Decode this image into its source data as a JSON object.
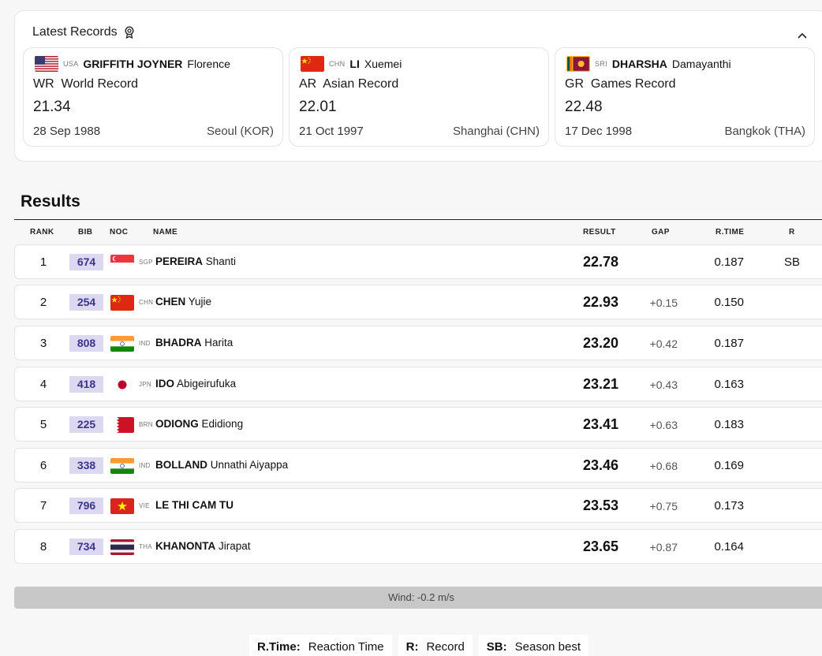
{
  "latest_records": {
    "title": "Latest Records",
    "cards": [
      {
        "noc": "USA",
        "last_name": "GRIFFITH JOYNER",
        "first_name": "Florence",
        "record_type": "WR  World Record",
        "time": "21.34",
        "date": "28 Sep 1988",
        "place": "Seoul (KOR)"
      },
      {
        "noc": "CHN",
        "last_name": "LI",
        "first_name": "Xuemei",
        "record_type": "AR  Asian Record",
        "time": "22.01",
        "date": "21 Oct 1997",
        "place": "Shanghai (CHN)"
      },
      {
        "noc": "SRI",
        "last_name": "DHARSHA",
        "first_name": "Damayanthi",
        "record_type": "GR  Games Record",
        "time": "22.48",
        "date": "17 Dec 1998",
        "place": "Bangkok (THA)"
      }
    ]
  },
  "results": {
    "title": "Results",
    "columns": {
      "rank": "RANK",
      "bib": "BIB",
      "noc": "NOC",
      "name": "NAME",
      "result": "RESULT",
      "gap": "GAP",
      "rtime": "R.TIME",
      "r": "R"
    },
    "rows": [
      {
        "rank": "1",
        "bib": "674",
        "noc": "SGP",
        "last_name": "PEREIRA",
        "first_name": "Shanti",
        "result": "22.78",
        "gap": "",
        "rtime": "0.187",
        "r": "SB"
      },
      {
        "rank": "2",
        "bib": "254",
        "noc": "CHN",
        "last_name": "CHEN",
        "first_name": "Yujie",
        "result": "22.93",
        "gap": "+0.15",
        "rtime": "0.150",
        "r": ""
      },
      {
        "rank": "3",
        "bib": "808",
        "noc": "IND",
        "last_name": "BHADRA",
        "first_name": "Harita",
        "result": "23.20",
        "gap": "+0.42",
        "rtime": "0.187",
        "r": ""
      },
      {
        "rank": "4",
        "bib": "418",
        "noc": "JPN",
        "last_name": "IDO",
        "first_name": "Abigeirufuka",
        "result": "23.21",
        "gap": "+0.43",
        "rtime": "0.163",
        "r": ""
      },
      {
        "rank": "5",
        "bib": "225",
        "noc": "BRN",
        "last_name": "ODIONG",
        "first_name": "Edidiong",
        "result": "23.41",
        "gap": "+0.63",
        "rtime": "0.183",
        "r": ""
      },
      {
        "rank": "6",
        "bib": "338",
        "noc": "IND",
        "last_name": "BOLLAND",
        "first_name": "Unnathi Aiyappa",
        "result": "23.46",
        "gap": "+0.68",
        "rtime": "0.169",
        "r": ""
      },
      {
        "rank": "7",
        "bib": "796",
        "noc": "VIE",
        "last_name": "LE THI CAM TU",
        "first_name": "",
        "result": "23.53",
        "gap": "+0.75",
        "rtime": "0.173",
        "r": ""
      },
      {
        "rank": "8",
        "bib": "734",
        "noc": "THA",
        "last_name": "KHANONTA",
        "first_name": "Jirapat",
        "result": "23.65",
        "gap": "+0.87",
        "rtime": "0.164",
        "r": ""
      }
    ],
    "wind": "Wind: -0.2 m/s"
  },
  "legend": [
    {
      "key": "R.Time:",
      "desc": "Reaction Time"
    },
    {
      "key": "R:",
      "desc": "Record"
    },
    {
      "key": "SB:",
      "desc": "Season best"
    }
  ],
  "colors": {
    "bib_bg": "#ddd8f2",
    "bib_text": "#3b3488",
    "wind_bar": "#c8c8c8"
  },
  "icons": {
    "records": "medal-icon",
    "collapse": "chevron-up-icon"
  }
}
